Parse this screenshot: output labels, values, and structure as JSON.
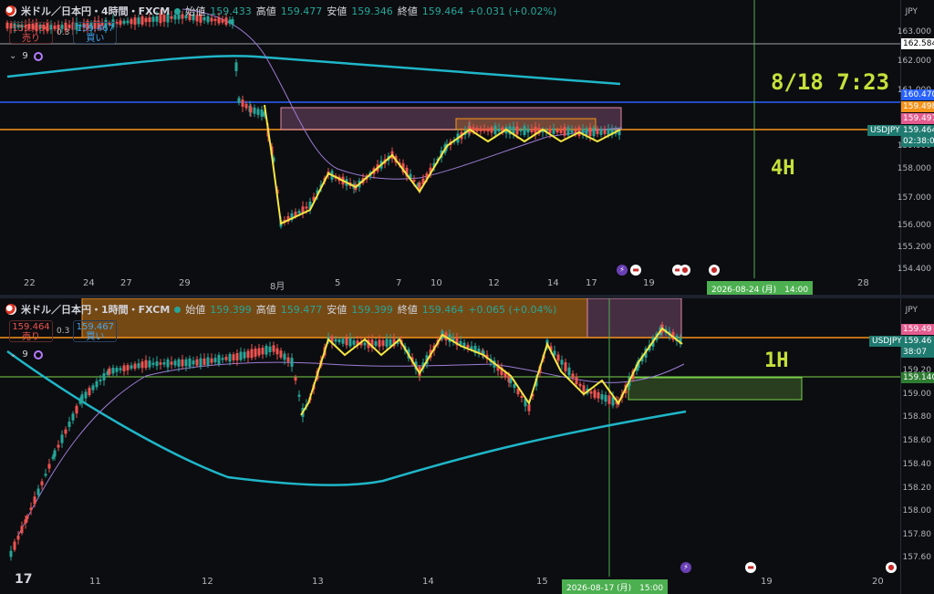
{
  "top": {
    "title": "米ドル／日本円・4時間・FXCM",
    "ohlc": {
      "o_label": "始値",
      "o": "159.433",
      "h_label": "高値",
      "h": "159.477",
      "l_label": "安値",
      "l": "159.346",
      "c_label": "終値",
      "c": "159.464",
      "chg": "+0.031 (+0.02%)"
    },
    "sell": {
      "price": "159.464",
      "label": "売り"
    },
    "buy": {
      "price": "159.467",
      "label": "買い"
    },
    "spread": "0.3",
    "indicator_count": "9",
    "currency": "JPY",
    "y_ticks": [
      "163.000",
      "162.000",
      "161.000",
      "160.000",
      "159.000",
      "158.000",
      "157.000",
      "156.000",
      "155.200",
      "154.400"
    ],
    "tags": {
      "level1": "162.584",
      "level2": "160.470",
      "level3": "159.498",
      "level4": "159.497",
      "price": "159.464",
      "countdown": "02:38:05",
      "symbol": "USDJPY"
    },
    "x_ticks": [
      "22",
      "24",
      "27",
      "29",
      "8月",
      "5",
      "7",
      "10",
      "12",
      "14",
      "17",
      "19",
      "28"
    ],
    "cursor_date": "2026-08-24 (月)　14:00",
    "annotation_time": "8/18 7:23",
    "annotation_tf": "4H"
  },
  "bottom": {
    "title": "米ドル／日本円・1時間・FXCM",
    "ohlc": {
      "o_label": "始値",
      "o": "159.399",
      "h_label": "高値",
      "h": "159.477",
      "l_label": "安値",
      "l": "159.399",
      "c_label": "終値",
      "c": "159.464",
      "chg": "+0.065 (+0.04%)"
    },
    "sell": {
      "price": "159.464",
      "label": "売り"
    },
    "buy": {
      "price": "159.467",
      "label": "買い"
    },
    "spread": "0.3",
    "indicator_count": "9",
    "currency": "JPY",
    "y_ticks": [
      "159.20",
      "159.00",
      "158.80",
      "158.60",
      "158.40",
      "158.20",
      "158.00",
      "157.80",
      "157.60"
    ],
    "tags": {
      "level1": "159.49",
      "price": "159.46",
      "countdown": "38:07",
      "symbol": "USDJPY",
      "level2": "159.140"
    },
    "x_ticks": [
      "11",
      "12",
      "13",
      "14",
      "15",
      "19",
      "20"
    ],
    "cursor_date": "2026-08-17 (月)　15:00",
    "annotation_tf": "1H"
  },
  "colors": {
    "up": "#26a69a",
    "down": "#ef5350",
    "yellow": "#f5e642",
    "cyan": "#1fb6c9",
    "orange": "#f7931a",
    "blue": "#2962ff",
    "green": "#7cd34a",
    "annotation": "#c6e03b"
  }
}
